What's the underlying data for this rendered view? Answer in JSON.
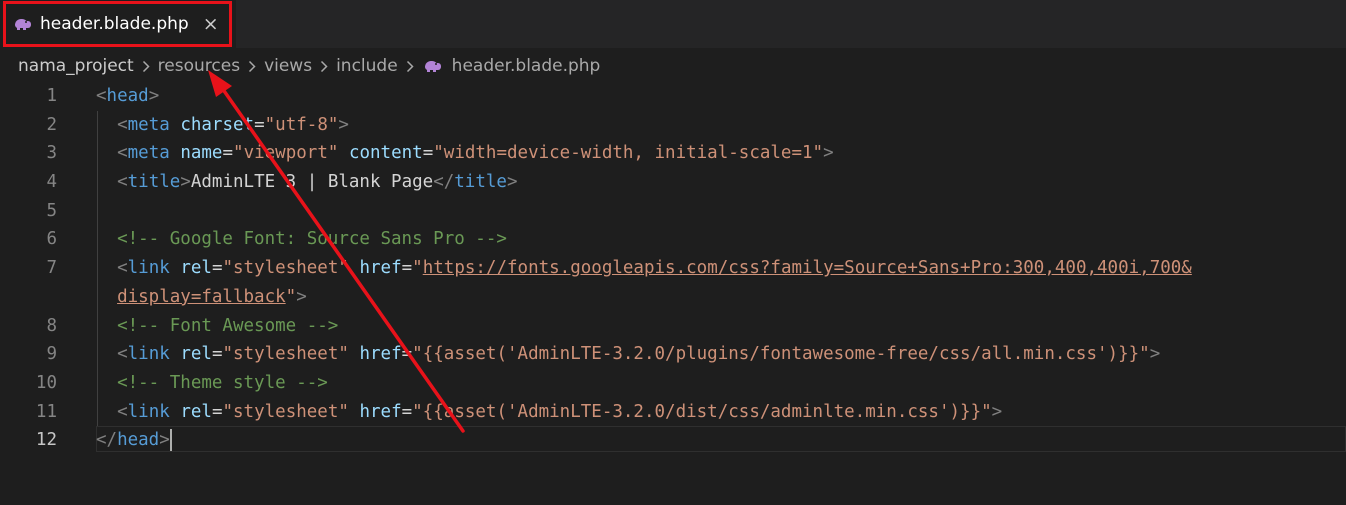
{
  "tab": {
    "title": "header.blade.php",
    "close_glyph": "×",
    "icon": "php-elephant-icon"
  },
  "breadcrumb": {
    "items": [
      "nama_project",
      "resources",
      "views",
      "include",
      "header.blade.php"
    ],
    "separator": "chevron-right-icon"
  },
  "editor": {
    "active_line": 12,
    "lines": [
      {
        "n": "1",
        "parts": [
          [
            "t",
            "<"
          ],
          [
            "tn",
            "head"
          ],
          [
            "t",
            ">"
          ]
        ]
      },
      {
        "n": "2",
        "parts": [
          [
            "tx",
            "  "
          ],
          [
            "t",
            "<"
          ],
          [
            "tn",
            "meta"
          ],
          [
            "tx",
            " "
          ],
          [
            "a",
            "charset"
          ],
          [
            "tx",
            "="
          ],
          [
            "s",
            "\"utf-8\""
          ],
          [
            "t",
            ">"
          ]
        ]
      },
      {
        "n": "3",
        "parts": [
          [
            "tx",
            "  "
          ],
          [
            "t",
            "<"
          ],
          [
            "tn",
            "meta"
          ],
          [
            "tx",
            " "
          ],
          [
            "a",
            "name"
          ],
          [
            "tx",
            "="
          ],
          [
            "s",
            "\"viewport\""
          ],
          [
            "tx",
            " "
          ],
          [
            "a",
            "content"
          ],
          [
            "tx",
            "="
          ],
          [
            "s",
            "\"width=device-width, initial-scale=1\""
          ],
          [
            "t",
            ">"
          ]
        ]
      },
      {
        "n": "4",
        "parts": [
          [
            "tx",
            "  "
          ],
          [
            "t",
            "<"
          ],
          [
            "tn",
            "title"
          ],
          [
            "t",
            ">"
          ],
          [
            "tx",
            "AdminLTE 3 | Blank Page"
          ],
          [
            "t",
            "</"
          ],
          [
            "tn",
            "title"
          ],
          [
            "t",
            ">"
          ]
        ]
      },
      {
        "n": "5",
        "parts": []
      },
      {
        "n": "6",
        "parts": [
          [
            "tx",
            "  "
          ],
          [
            "c",
            "<!-- Google Font: Source Sans Pro -->"
          ]
        ]
      },
      {
        "n": "7",
        "parts": [
          [
            "tx",
            "  "
          ],
          [
            "t",
            "<"
          ],
          [
            "tn",
            "link"
          ],
          [
            "tx",
            " "
          ],
          [
            "a",
            "rel"
          ],
          [
            "tx",
            "="
          ],
          [
            "s",
            "\"stylesheet\""
          ],
          [
            "tx",
            " "
          ],
          [
            "a",
            "href"
          ],
          [
            "tx",
            "="
          ],
          [
            "s",
            "\""
          ],
          [
            "su",
            "https://fonts.googleapis.com/css?family=Source+Sans+Pro:300,400,400i,700&"
          ]
        ]
      },
      {
        "n": "",
        "parts": [
          [
            "tx",
            "  "
          ],
          [
            "su",
            "display=fallback"
          ],
          [
            "s",
            "\""
          ],
          [
            "t",
            ">"
          ]
        ]
      },
      {
        "n": "8",
        "parts": [
          [
            "tx",
            "  "
          ],
          [
            "c",
            "<!-- Font Awesome -->"
          ]
        ]
      },
      {
        "n": "9",
        "parts": [
          [
            "tx",
            "  "
          ],
          [
            "t",
            "<"
          ],
          [
            "tn",
            "link"
          ],
          [
            "tx",
            " "
          ],
          [
            "a",
            "rel"
          ],
          [
            "tx",
            "="
          ],
          [
            "s",
            "\"stylesheet\""
          ],
          [
            "tx",
            " "
          ],
          [
            "a",
            "href"
          ],
          [
            "tx",
            "="
          ],
          [
            "s",
            "\"{{asset('AdminLTE-3.2.0/plugins/fontawesome-free/css/all.min.css')}}\""
          ],
          [
            "t",
            ">"
          ]
        ]
      },
      {
        "n": "10",
        "parts": [
          [
            "tx",
            "  "
          ],
          [
            "c",
            "<!-- Theme style -->"
          ]
        ]
      },
      {
        "n": "11",
        "parts": [
          [
            "tx",
            "  "
          ],
          [
            "t",
            "<"
          ],
          [
            "tn",
            "link"
          ],
          [
            "tx",
            " "
          ],
          [
            "a",
            "rel"
          ],
          [
            "tx",
            "="
          ],
          [
            "s",
            "\"stylesheet\""
          ],
          [
            "tx",
            " "
          ],
          [
            "a",
            "href"
          ],
          [
            "tx",
            "="
          ],
          [
            "s",
            "\"{{asset('AdminLTE-3.2.0/dist/css/adminlte.min.css')}}\""
          ],
          [
            "t",
            ">"
          ]
        ]
      },
      {
        "n": "12",
        "parts": [
          [
            "t",
            "</"
          ],
          [
            "tn",
            "head"
          ],
          [
            "t",
            ">"
          ]
        ]
      }
    ]
  },
  "annotation": {
    "color": "#e8121a",
    "box_target": "tab",
    "arrow_target": "breadcrumb-resources"
  }
}
